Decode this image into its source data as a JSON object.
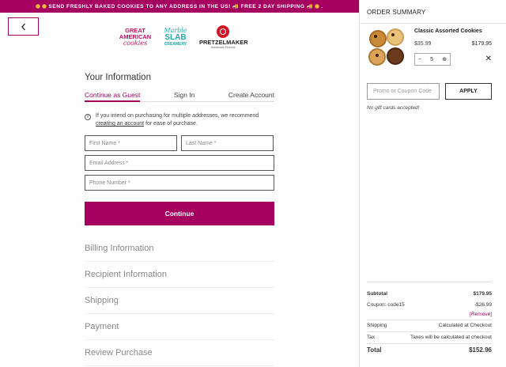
{
  "banner": {
    "text": "SEND FRESHLY BAKED COOKIES TO ANY ADDRESS IN THE US!",
    "text2": "FREE 2 DAY SHIPPING"
  },
  "back": {
    "glyph": "‹"
  },
  "logos": {
    "gac_line1": "GREAT",
    "gac_line2": "AMERICAN",
    "gac_line3": "cookies",
    "mss_line1": "Marble",
    "mss_line2": "SLAB",
    "mss_line3": "CREAMERY",
    "pz_name": "PRETZELMAKER",
    "pz_sub": "Handmade Pretzels"
  },
  "form": {
    "heading": "Your Information",
    "tabs": [
      {
        "label": "Continue as Guest",
        "active": true
      },
      {
        "label": "Sign In",
        "active": false
      },
      {
        "label": "Create Account",
        "active": false
      }
    ],
    "info_text": "If you intend on purchasing for multiple addresses, we recommend",
    "info_link": "creating an account",
    "info_suffix": "for ease of purchase.",
    "first_name_placeholder": "First Name *",
    "last_name_placeholder": "Last Name *",
    "email_placeholder": "Email Address *",
    "phone_placeholder": "Phone Number *",
    "continue_label": "Continue"
  },
  "steps": [
    "Billing Information",
    "Recipient Information",
    "Shipping",
    "Payment",
    "Review Purchase"
  ],
  "summary": {
    "title": "ORDER SUMMARY",
    "item": {
      "name": "Classic Assorted Cookies",
      "price": "$35.99",
      "total": "$179.95",
      "quantity": "5",
      "minus": "−",
      "plus": "⊕",
      "remove": "✕"
    },
    "promo_placeholder": "Promo or Coupon Code",
    "apply_label": "APPLY",
    "no_gift": "No gift cards accepted!",
    "subtotal_label": "Subtotal",
    "subtotal_value": "$179.95",
    "coupon_label": "Coupon: code15",
    "coupon_value": "-$26.99",
    "remove_label": "[Remove]",
    "shipping_label": "Shipping",
    "shipping_value": "Calculated at Checkout",
    "tax_label": "Tax",
    "tax_value": "Taxes will be calculated at checkout",
    "total_label": "Total",
    "total_value": "$152.96"
  },
  "colors": {
    "brand": "#a5005f",
    "mss_teal": "#1fa9a6",
    "pz_red": "#d2142a"
  }
}
